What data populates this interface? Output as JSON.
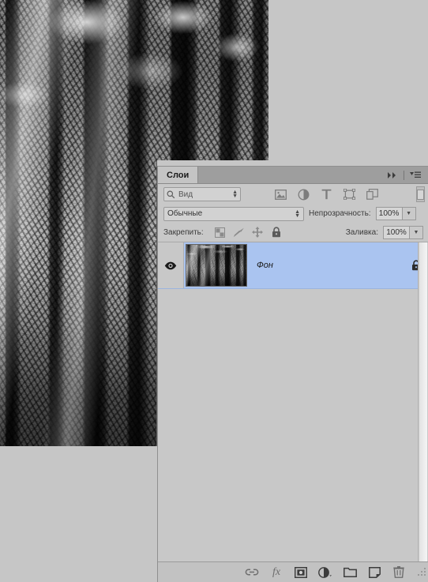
{
  "app": {
    "document_title": "",
    "canvas_background": "#c6c6c6"
  },
  "photo": {
    "name": "forest-black-and-white-photo",
    "description": "Black and white photograph of tall tree trunks in a misty forest"
  },
  "panel": {
    "tab_label": "Слои",
    "collapse_icon": "double-chevron-right-icon",
    "menu_icon": "panel-menu-icon",
    "filter": {
      "search_icon": "magnifier-icon",
      "value": "Вид",
      "spinner_up": "▲",
      "spinner_down": "▼",
      "type_icons": [
        {
          "name": "pixel-layers-filter-icon"
        },
        {
          "name": "adjustment-layers-filter-icon"
        },
        {
          "name": "type-layers-filter-icon"
        },
        {
          "name": "shape-layers-filter-icon"
        },
        {
          "name": "smart-object-filter-icon"
        }
      ],
      "toggle_name": "filter-enable-toggle"
    },
    "blend": {
      "mode_value": "Обычные",
      "opacity_label": "Непрозрачность:",
      "opacity_value": "100%",
      "fill_label": "Заливка:",
      "fill_value": "100%"
    },
    "lock": {
      "label": "Закрепить:",
      "items": [
        {
          "name": "lock-transparent-pixels-icon",
          "active": false
        },
        {
          "name": "lock-image-pixels-icon",
          "active": false
        },
        {
          "name": "lock-position-icon",
          "active": false
        },
        {
          "name": "lock-all-icon",
          "active": true
        }
      ]
    },
    "layers": [
      {
        "name": "Фон",
        "visible": true,
        "locked": true,
        "selected": true,
        "eye_icon": "eye-icon",
        "lock_icon": "lock-icon"
      }
    ],
    "footer_buttons": [
      {
        "name": "link-layers-icon",
        "label": ""
      },
      {
        "name": "layer-styles-fx-icon",
        "label": "fx"
      },
      {
        "name": "add-layer-mask-icon",
        "label": ""
      },
      {
        "name": "new-adjustment-layer-icon",
        "label": ""
      },
      {
        "name": "new-group-icon",
        "label": ""
      },
      {
        "name": "new-layer-icon",
        "label": ""
      },
      {
        "name": "delete-layer-icon",
        "label": ""
      }
    ],
    "resize_grip": "resize-grip-icon"
  },
  "colors": {
    "panel_bg": "#c8c8c8",
    "header_bg": "#9e9e9e",
    "tab_bg": "#c4c4c4",
    "selection_blue": "#aac4f0",
    "canvas_gray": "#c6c6c6"
  }
}
